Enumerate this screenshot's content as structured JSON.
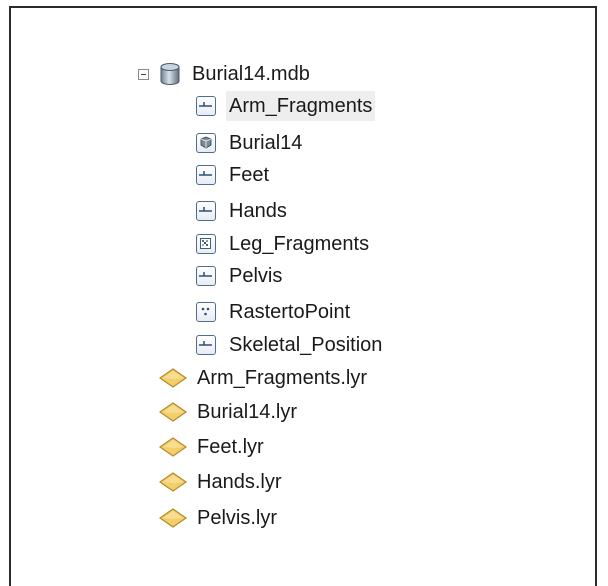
{
  "tree": {
    "database": {
      "label": "Burial14.mdb",
      "icon": "database-icon",
      "expanded": true,
      "children": [
        {
          "label": "Arm_Fragments",
          "icon": "line-feature-class-icon",
          "selected": true
        },
        {
          "label": "Burial14",
          "icon": "toolbox-icon"
        },
        {
          "label": "Feet",
          "icon": "line-feature-class-icon"
        },
        {
          "label": "Hands",
          "icon": "line-feature-class-icon"
        },
        {
          "label": "Leg_Fragments",
          "icon": "raster-dataset-icon"
        },
        {
          "label": "Pelvis",
          "icon": "line-feature-class-icon"
        },
        {
          "label": "RastertoPoint",
          "icon": "point-feature-class-icon"
        },
        {
          "label": "Skeletal_Position",
          "icon": "line-feature-class-icon"
        }
      ]
    },
    "layer_files": [
      {
        "label": "Arm_Fragments.lyr",
        "icon": "layer-file-icon"
      },
      {
        "label": "Burial14.lyr",
        "icon": "layer-file-icon"
      },
      {
        "label": "Feet.lyr",
        "icon": "layer-file-icon"
      },
      {
        "label": "Hands.lyr",
        "icon": "layer-file-icon"
      },
      {
        "label": "Pelvis.lyr",
        "icon": "layer-file-icon"
      }
    ]
  },
  "colors": {
    "layer_icon_fill": "#f2cf6a",
    "layer_icon_stroke": "#b8892a",
    "icon_stroke": "#4f6e8f",
    "selection": "#eeeeee"
  }
}
